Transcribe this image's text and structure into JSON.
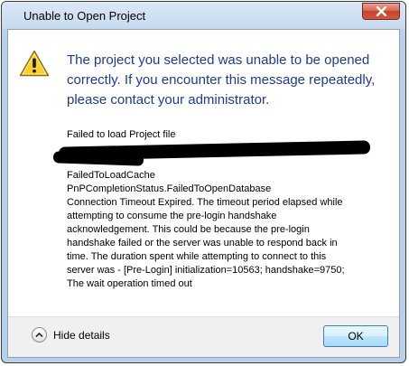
{
  "window": {
    "title": "Unable to Open Project"
  },
  "dialog": {
    "icon": "warning-icon",
    "main_instruction": "The project you selected was unable to be opened correctly. If you encounter this message repeatedly, please contact your administrator.",
    "details_lines": [
      "Failed to load Project file",
      "",
      "",
      "FailedToLoadCache",
      "PnPCompletionStatus.FailedToOpenDatabase",
      "Connection Timeout Expired.  The timeout period elapsed while",
      "attempting to consume the pre-login handshake",
      "acknowledgement.  This could be because the pre-login",
      "handshake failed or the server was unable to respond back in",
      "time.  The duration spent while attempting to connect to this",
      "server was - [Pre-Login] initialization=10563; handshake=9750;",
      "The wait operation timed out"
    ]
  },
  "footer": {
    "toggle_label": "Hide details",
    "ok_label": "OK"
  },
  "colors": {
    "instruction_text": "#1c3a97",
    "title_bar": "#c6daf0",
    "close_button": "#c6432b",
    "warning_yellow": "#f7d02c"
  }
}
